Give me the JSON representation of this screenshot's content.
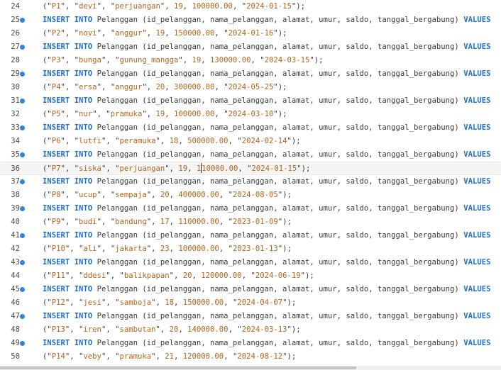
{
  "colors": {
    "keyword": "#1f6fd1",
    "string": "#b5651d",
    "breakpoint": "#2f86d6"
  },
  "editor": {
    "cursor": {
      "line": 36,
      "char_index": 28
    },
    "lines": [
      {
        "number": "24",
        "kind": "values",
        "id": "P1",
        "name": "devi",
        "address": "perjuangan",
        "age": "19",
        "saldo": "100000.00",
        "date": "2024-01-15"
      },
      {
        "number": "25",
        "kind": "insert",
        "breakpoint": true
      },
      {
        "number": "26",
        "kind": "values",
        "id": "P2",
        "name": "novi",
        "address": "anggur",
        "age": "19",
        "saldo": "150000.00",
        "date": "2024-01-16"
      },
      {
        "number": "27",
        "kind": "insert",
        "breakpoint": true
      },
      {
        "number": "28",
        "kind": "values",
        "id": "P3",
        "name": "bunga",
        "address": "gunung_mangga",
        "age": "19",
        "saldo": "130000.00",
        "date": "2024-03-15"
      },
      {
        "number": "29",
        "kind": "insert",
        "breakpoint": true
      },
      {
        "number": "30",
        "kind": "values",
        "id": "P4",
        "name": "ersa",
        "address": "anggur",
        "age": "20",
        "saldo": "300000.00",
        "date": "2024-05-25"
      },
      {
        "number": "31",
        "kind": "insert",
        "breakpoint": true
      },
      {
        "number": "32",
        "kind": "values",
        "id": "P5",
        "name": "nur",
        "address": "pramuka",
        "age": "19",
        "saldo": "100000.00",
        "date": "2024-03-10"
      },
      {
        "number": "33",
        "kind": "insert",
        "breakpoint": true
      },
      {
        "number": "34",
        "kind": "values",
        "id": "P6",
        "name": "lutfi",
        "address": "peramuka",
        "age": "18",
        "saldo": "500000.00",
        "date": "2024-02-14"
      },
      {
        "number": "35",
        "kind": "insert",
        "breakpoint": true
      },
      {
        "number": "36",
        "kind": "values",
        "id": "P7",
        "name": "siska",
        "address": "perjuangan",
        "age": "19",
        "saldo": "110000.00",
        "date": "2024-01-15",
        "active": true
      },
      {
        "number": "37",
        "kind": "insert",
        "breakpoint": true
      },
      {
        "number": "38",
        "kind": "values",
        "id": "P8",
        "name": "ucup",
        "address": "sempaja",
        "age": "20",
        "saldo": "400000.00",
        "date": "2024-08-05"
      },
      {
        "number": "39",
        "kind": "insert",
        "breakpoint": true
      },
      {
        "number": "40",
        "kind": "values",
        "id": "P9",
        "name": "budi",
        "address": "bandung",
        "age": "17",
        "saldo": "110000.00",
        "date": "2023-01-09"
      },
      {
        "number": "41",
        "kind": "insert",
        "breakpoint": true
      },
      {
        "number": "42",
        "kind": "values",
        "id": "P10",
        "name": "ali",
        "address": "jakarta",
        "age": "23",
        "saldo": "100000.00",
        "date": "2023-01-13"
      },
      {
        "number": "43",
        "kind": "insert",
        "breakpoint": true
      },
      {
        "number": "44",
        "kind": "values",
        "id": "P11",
        "name": "ddesi",
        "address": "balikpapan",
        "age": "20",
        "saldo": "120000.00",
        "date": "2024-06-19"
      },
      {
        "number": "45",
        "kind": "insert",
        "breakpoint": true
      },
      {
        "number": "46",
        "kind": "values",
        "id": "P12",
        "name": "jesi",
        "address": "samboja",
        "age": "18",
        "saldo": "150000.00",
        "date": "2024-04-07"
      },
      {
        "number": "47",
        "kind": "insert",
        "breakpoint": true
      },
      {
        "number": "48",
        "kind": "values",
        "id": "P13",
        "name": "iren",
        "address": "sambutan",
        "age": "20",
        "saldo": "140000.00",
        "date": "2024-03-13"
      },
      {
        "number": "49",
        "kind": "insert",
        "breakpoint": true
      },
      {
        "number": "50",
        "kind": "values",
        "id": "P14",
        "name": "veby",
        "address": "pramuka",
        "age": "21",
        "saldo": "120000.00",
        "date": "2024-08-12"
      }
    ],
    "insert_tokens": {
      "kw_insert": "INSERT",
      "kw_into": "INTO",
      "table": " Pelanggan (id_pelanggan, nama_pelanggan, alamat, umur, saldo, tanggal_bergabung) ",
      "kw_values": "VALUES"
    }
  }
}
